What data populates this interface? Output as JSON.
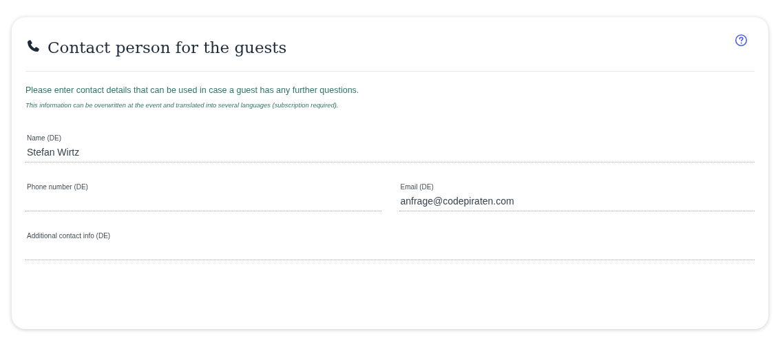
{
  "card": {
    "title": "Contact person for the guests",
    "intro": "Please enter contact details that can be used in case a guest has any further questions.",
    "note": "This information can be overwritten at the event and translated into several languages (subscription required).",
    "rows": [
      [
        {
          "label": "Name (DE)",
          "value": "Stefan Wirtz"
        }
      ],
      [
        {
          "label": "Phone number (DE)"
        },
        {
          "label": "Email (DE)",
          "value": "anfrage@codepiraten.com"
        }
      ],
      [
        {
          "label": "Additional contact info (DE)"
        }
      ]
    ]
  }
}
